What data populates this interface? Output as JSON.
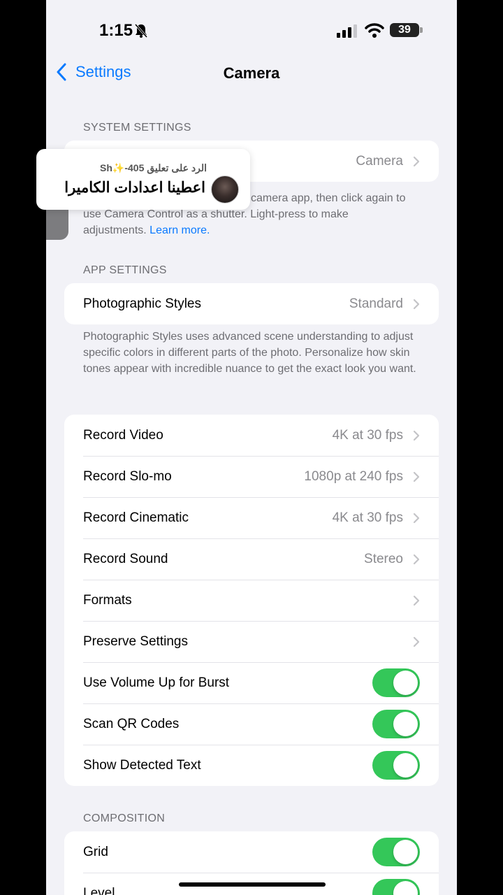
{
  "status_bar": {
    "time": "1:15",
    "battery": "39"
  },
  "nav": {
    "back_label": "Settings",
    "title": "Camera"
  },
  "system_settings": {
    "header": "SYSTEM SETTINGS",
    "row_value": "Camera",
    "footer_line1": "camera app, then click again to",
    "footer_line2": "use Camera Control as a shutter. Light-press to make",
    "footer_line3": "adjustments.",
    "footer_link": "Learn more."
  },
  "app_settings": {
    "header": "APP SETTINGS",
    "photographic_styles": {
      "label": "Photographic Styles",
      "value": "Standard"
    },
    "footer": "Photographic Styles uses advanced scene understanding to adjust specific colors in different parts of the photo. Personalize how skin tones appear with incredible nuance to get the exact look you want."
  },
  "recording": {
    "rows": [
      {
        "label": "Record Video",
        "value": "4K at 30 fps"
      },
      {
        "label": "Record Slo-mo",
        "value": "1080p at 240 fps"
      },
      {
        "label": "Record Cinematic",
        "value": "4K at 30 fps"
      },
      {
        "label": "Record Sound",
        "value": "Stereo"
      },
      {
        "label": "Formats",
        "value": ""
      },
      {
        "label": "Preserve Settings",
        "value": ""
      }
    ],
    "toggles": [
      {
        "label": "Use Volume Up for Burst",
        "on": true
      },
      {
        "label": "Scan QR Codes",
        "on": true
      },
      {
        "label": "Show Detected Text",
        "on": true
      }
    ]
  },
  "composition": {
    "header": "COMPOSITION",
    "toggles": [
      {
        "label": "Grid",
        "on": true
      },
      {
        "label": "Level",
        "on": true
      }
    ]
  },
  "overlay": {
    "reply_to": "الرد على تعليق 405-✨Sh",
    "message": "اعطينا اعدادات الكاميرا"
  },
  "colors": {
    "accent": "#0a7aff",
    "toggle_on": "#34c759",
    "background": "#f2f2f7"
  }
}
